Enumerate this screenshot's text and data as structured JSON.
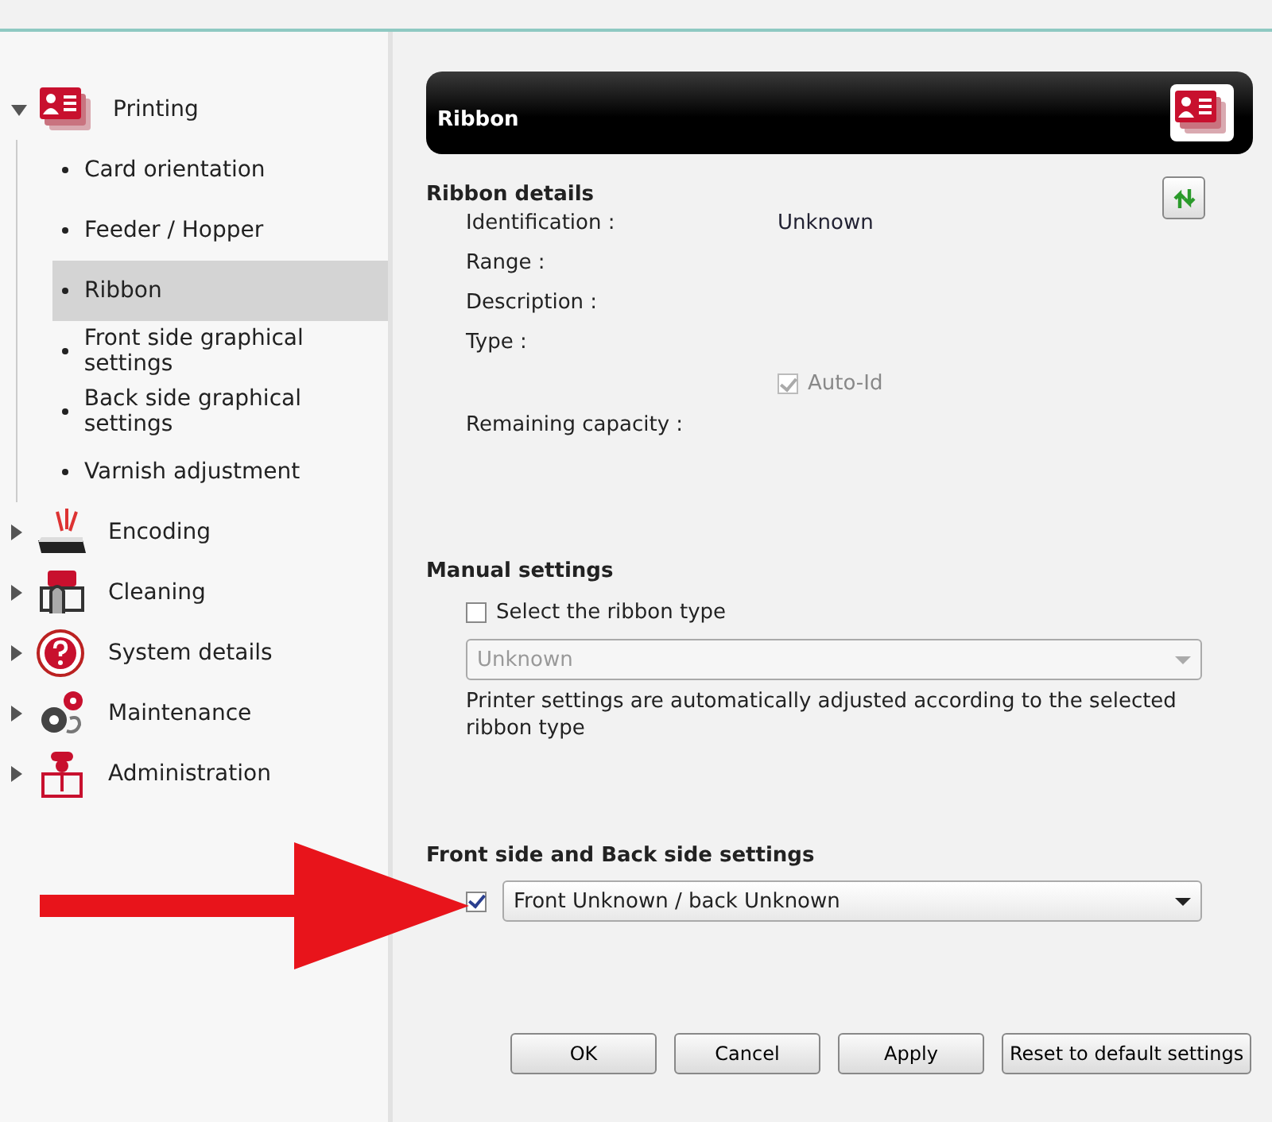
{
  "sidebar": {
    "items": [
      {
        "label": "Printing",
        "expanded": true,
        "children": [
          {
            "label": "Card orientation",
            "selected": false
          },
          {
            "label": "Feeder / Hopper",
            "selected": false
          },
          {
            "label": "Ribbon",
            "selected": true
          },
          {
            "label": "Front side graphical settings",
            "selected": false
          },
          {
            "label": "Back side graphical settings",
            "selected": false
          },
          {
            "label": "Varnish adjustment",
            "selected": false
          }
        ]
      },
      {
        "label": "Encoding",
        "expanded": false
      },
      {
        "label": "Cleaning",
        "expanded": false
      },
      {
        "label": "System details",
        "expanded": false
      },
      {
        "label": "Maintenance",
        "expanded": false
      },
      {
        "label": "Administration",
        "expanded": false
      }
    ]
  },
  "header": {
    "title": "Ribbon"
  },
  "ribbon_details": {
    "title": "Ribbon details",
    "fields": [
      {
        "label": "Identification :",
        "value": "Unknown"
      },
      {
        "label": "Range :"
      },
      {
        "label": "Description :"
      },
      {
        "label": "Type :"
      }
    ],
    "auto_id": {
      "label": "Auto-Id",
      "checked": true,
      "disabled": true
    },
    "remaining_capacity": {
      "label": "Remaining capacity :"
    }
  },
  "manual_settings": {
    "title": "Manual settings",
    "checkbox": {
      "label": "Select the ribbon  type",
      "checked": false
    },
    "dropdown": {
      "value": "Unknown",
      "disabled": true
    },
    "note": "Printer settings are automatically adjusted according to the selected ribbon type"
  },
  "front_back_settings": {
    "title": "Front side and Back side settings",
    "checked": true,
    "dropdown": {
      "value": "Front Unknown / back Unknown",
      "disabled": false
    }
  },
  "buttons": [
    "OK",
    "Cancel",
    "Apply",
    "Reset to default settings"
  ]
}
